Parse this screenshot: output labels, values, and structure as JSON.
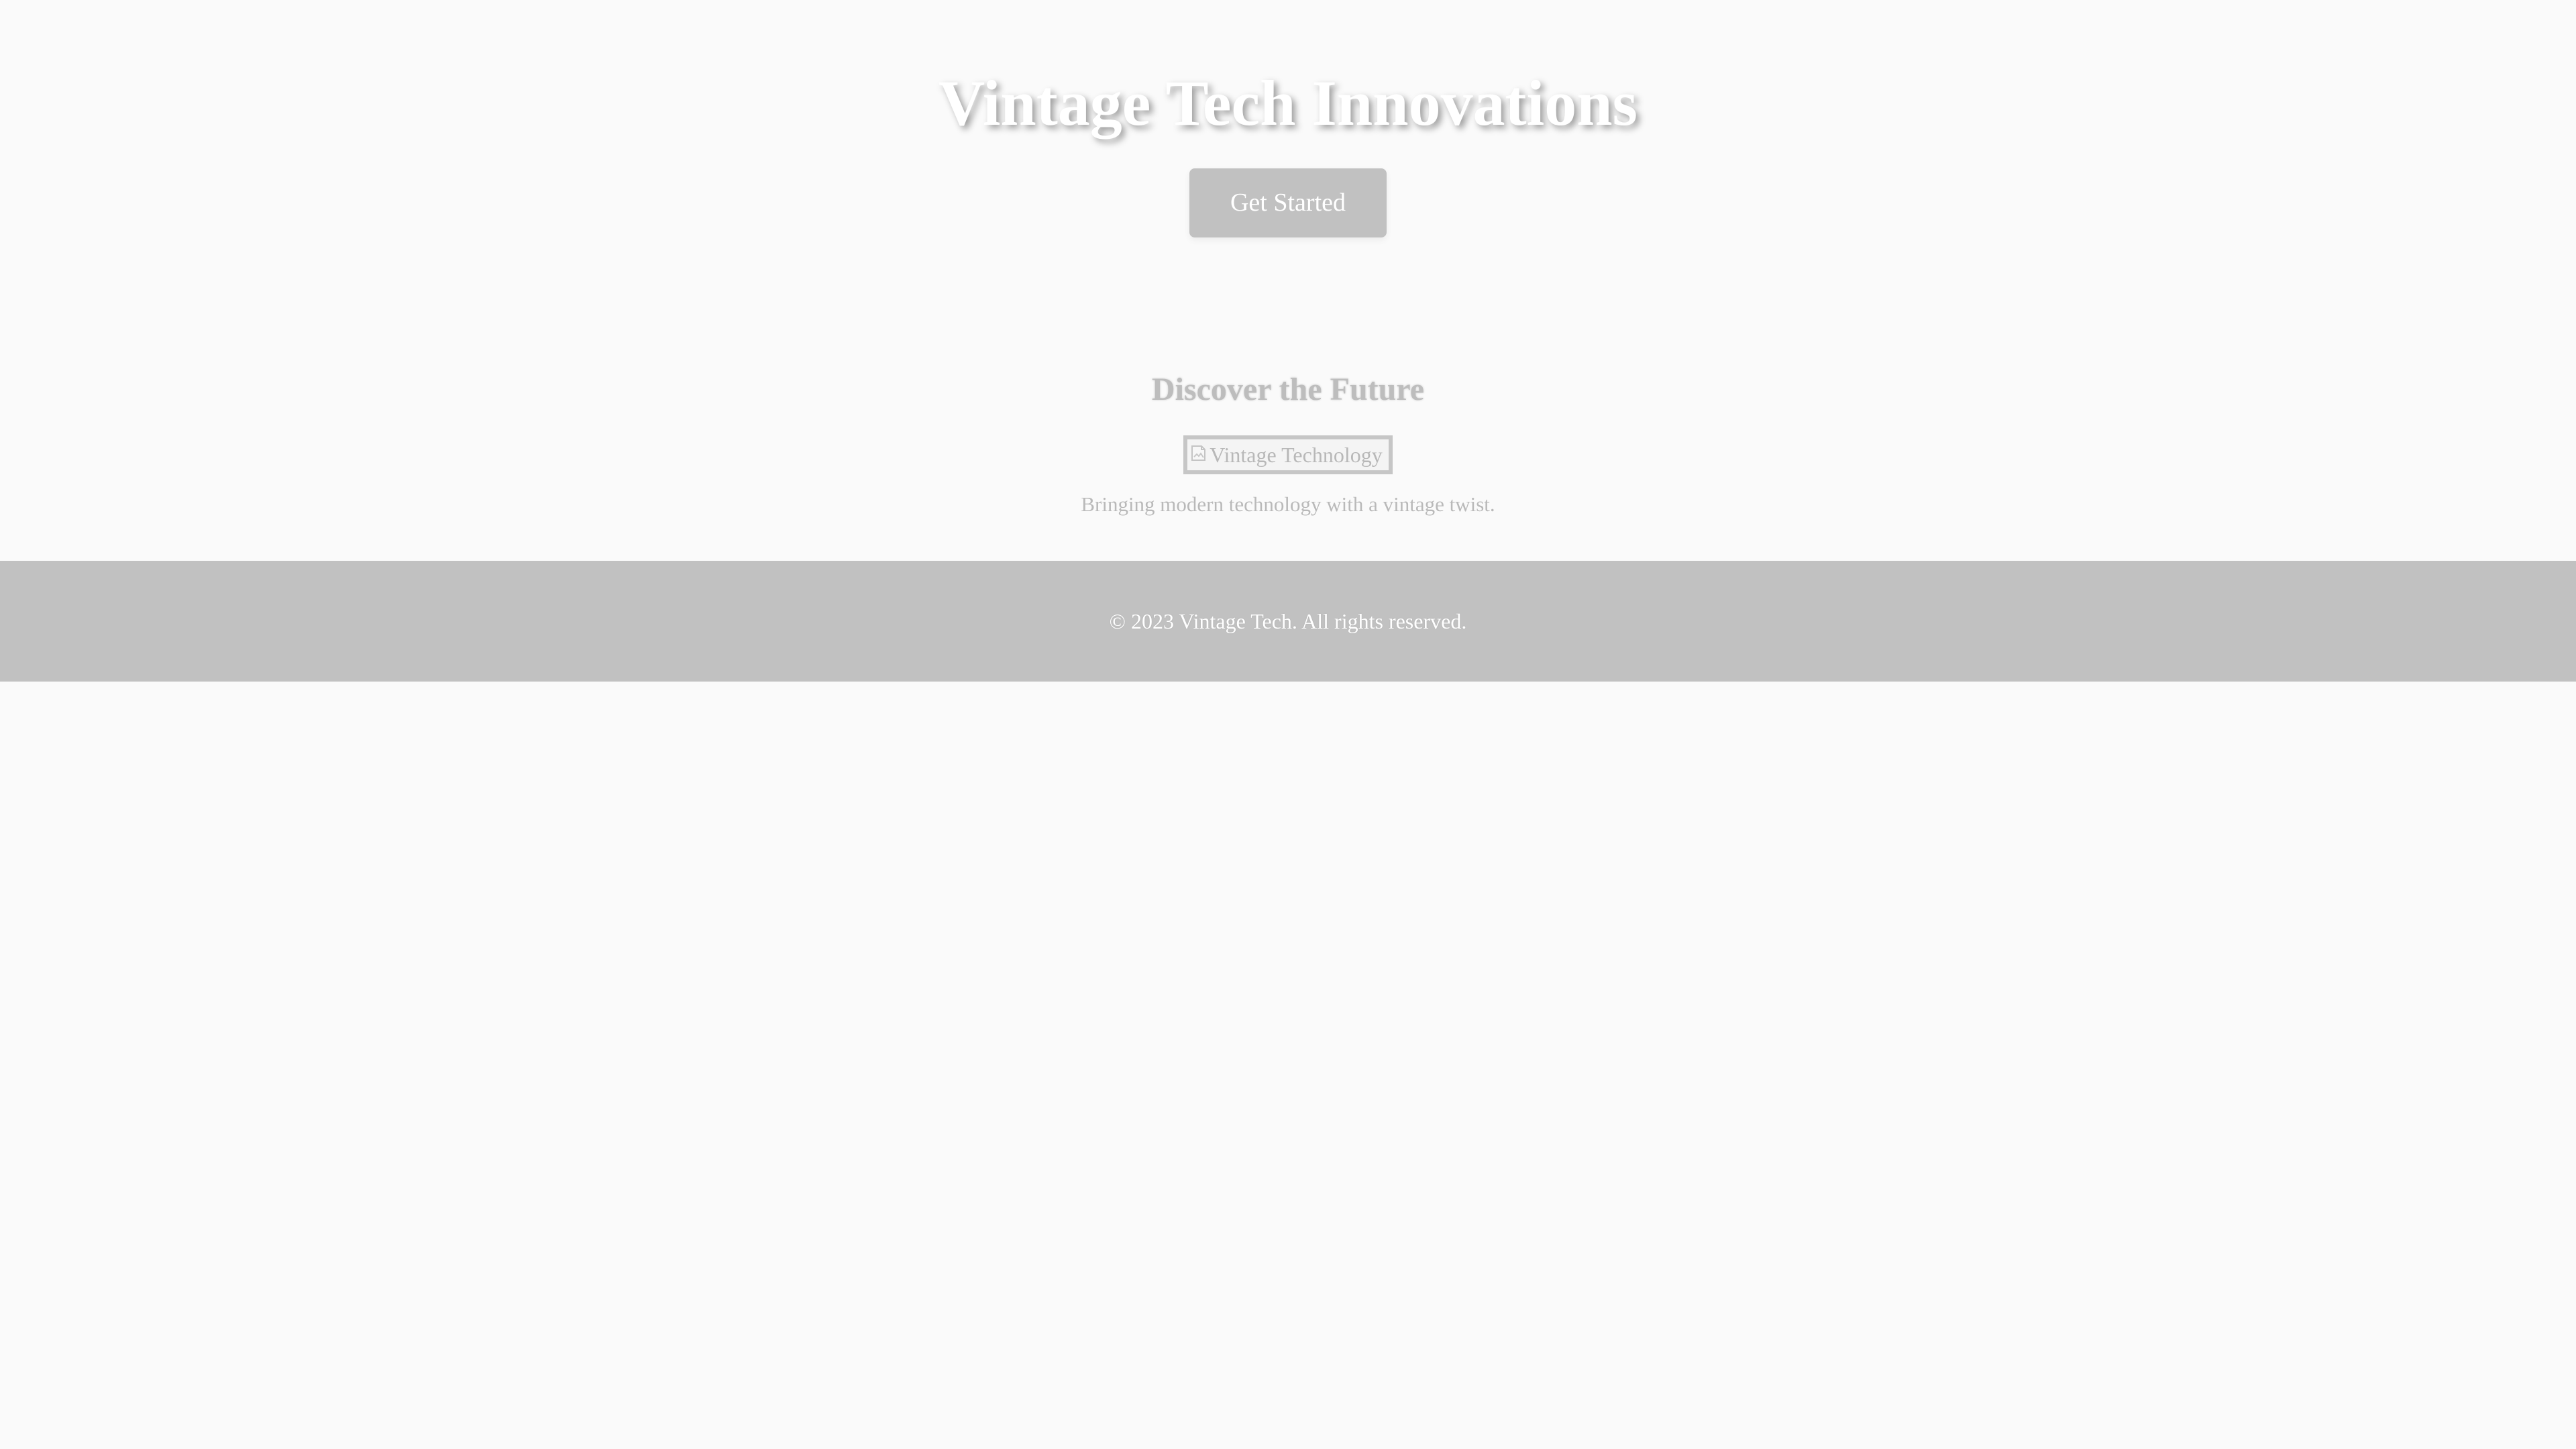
{
  "hero": {
    "title": "Vintage Tech Innovations",
    "button_label": "Get Started"
  },
  "feature": {
    "title": "Discover the Future",
    "image_alt": "Vintage Technology",
    "description": "Bringing modern technology with a vintage twist."
  },
  "footer": {
    "copyright": "© 2023 Vintage Tech. All rights reserved."
  },
  "icons": {
    "image": "broken-image-icon"
  },
  "colors": {
    "page_background": "#fafafa",
    "button_background": "#c1c1c1",
    "footer_background": "#c1c1c1",
    "text_primary": "#ffffff",
    "text_muted": "#b9b9b9"
  }
}
